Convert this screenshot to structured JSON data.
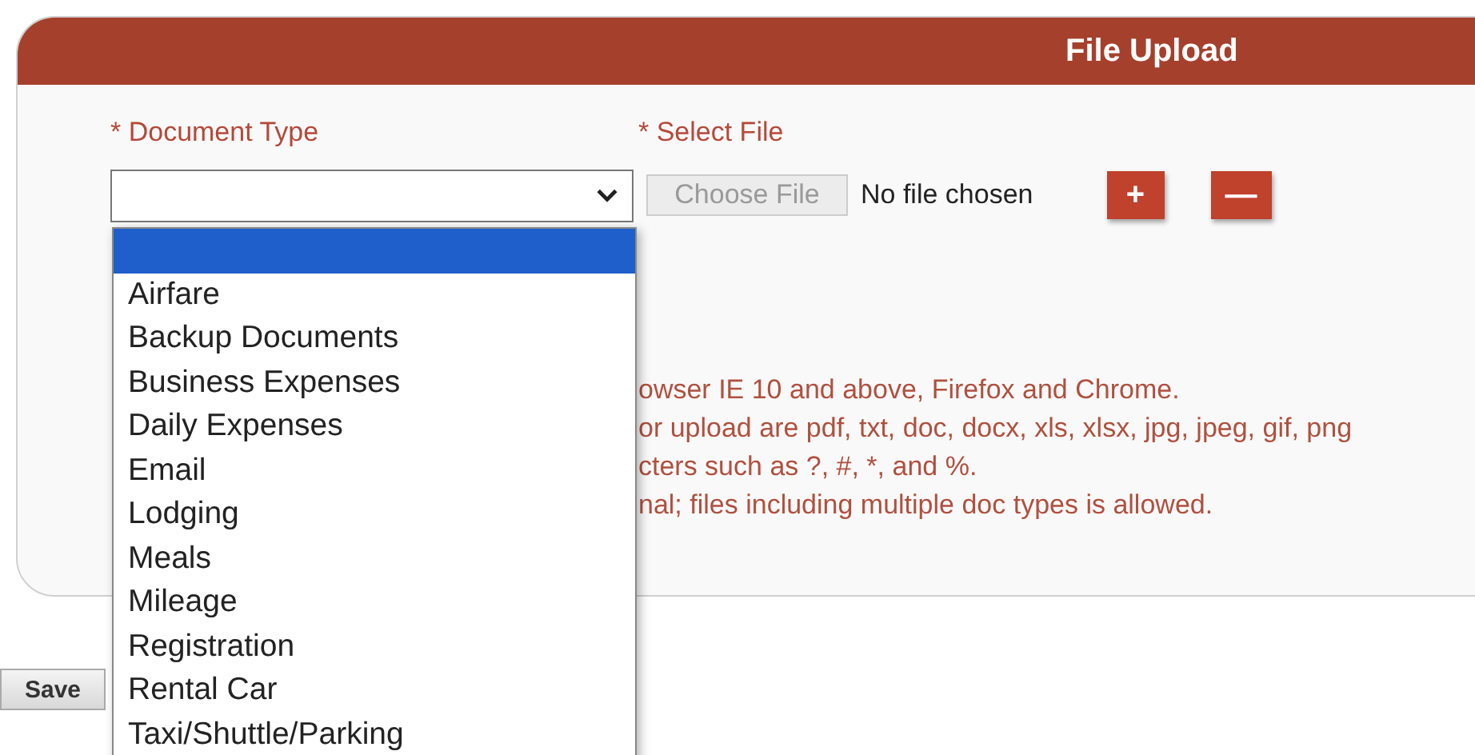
{
  "panel": {
    "title": "File Upload"
  },
  "form": {
    "document_type_label": "* Document Type",
    "select_file_label": "* Select File",
    "choose_file_button": "Choose File",
    "file_status": "No file chosen",
    "add_button": "+",
    "remove_button": "—"
  },
  "dropdown": {
    "options": [
      {
        "selected": true
      },
      {
        "label": "Airfare",
        "selected": false
      },
      {
        "label": "Backup Documents",
        "selected": false
      },
      {
        "label": "Business Expenses",
        "selected": false
      },
      {
        "label": "Daily Expenses",
        "selected": false
      },
      {
        "label": "Email",
        "selected": false
      },
      {
        "label": "Lodging",
        "selected": false
      },
      {
        "label": "Meals",
        "selected": false
      },
      {
        "label": "Mileage",
        "selected": false
      },
      {
        "label": "Registration",
        "selected": false
      },
      {
        "label": "Rental Car",
        "selected": false
      },
      {
        "label": "Taxi/Shuttle/Parking",
        "selected": false
      }
    ]
  },
  "notes": [
    {
      "text": "owser IE 10 and above, Firefox and Chrome."
    },
    {
      "text": "or upload are pdf, txt, doc, docx, xls, xlsx, jpg, jpeg, gif, png"
    },
    {
      "text": "cters such as ?, #, *, and %."
    },
    {
      "text": "nal; files including multiple doc types is allowed."
    }
  ],
  "save_button": "Save"
}
